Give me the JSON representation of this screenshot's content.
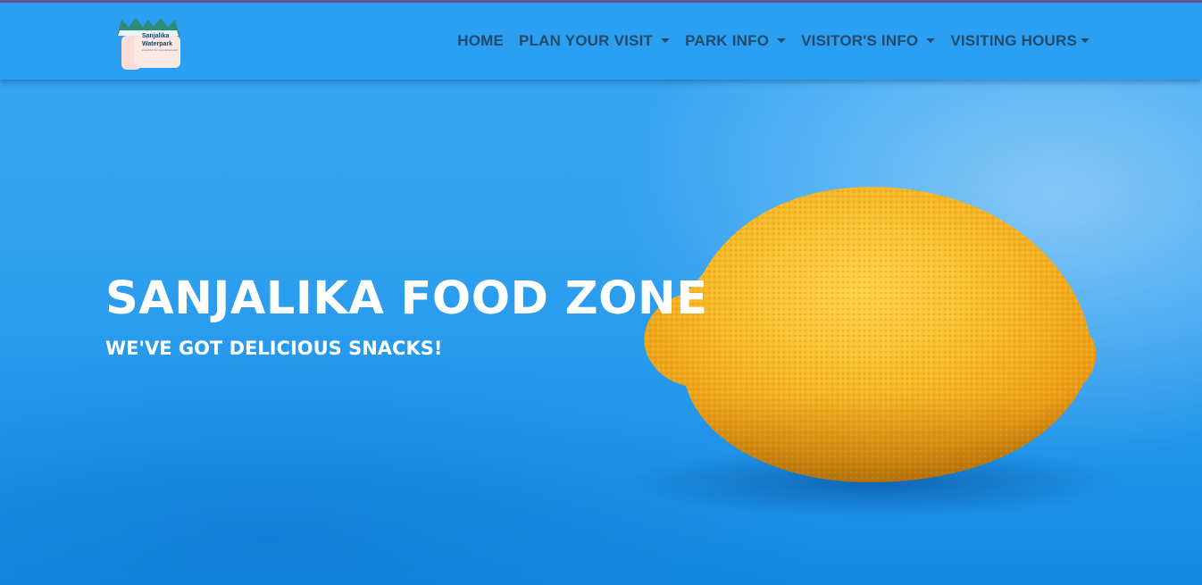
{
  "logo": {
    "name_line1": "Sanjalika",
    "name_line2": "Waterpark",
    "tagline": "a world of fun & entertainment",
    "icon": "waterpark-logo-icon"
  },
  "nav": {
    "items": [
      {
        "label": "HOME",
        "dropdown": false
      },
      {
        "label": "PLAN YOUR VISIT",
        "dropdown": true
      },
      {
        "label": "PARK INFO",
        "dropdown": true
      },
      {
        "label": "VISITOR'S INFO",
        "dropdown": true
      },
      {
        "label": "VISITING HOURS",
        "dropdown": true
      }
    ]
  },
  "hero": {
    "title": "SANJALIKA FOOD ZONE",
    "subtitle": "WE'VE GOT DELICIOUS SNACKS!",
    "image": "lemon-on-blue-background"
  },
  "colors": {
    "navbar_bg": "#2b9ff2",
    "nav_text": "#244a6a",
    "hero_bg": "#2f9fef",
    "hero_text": "#ffffff",
    "lemon": "#f5b82a"
  }
}
